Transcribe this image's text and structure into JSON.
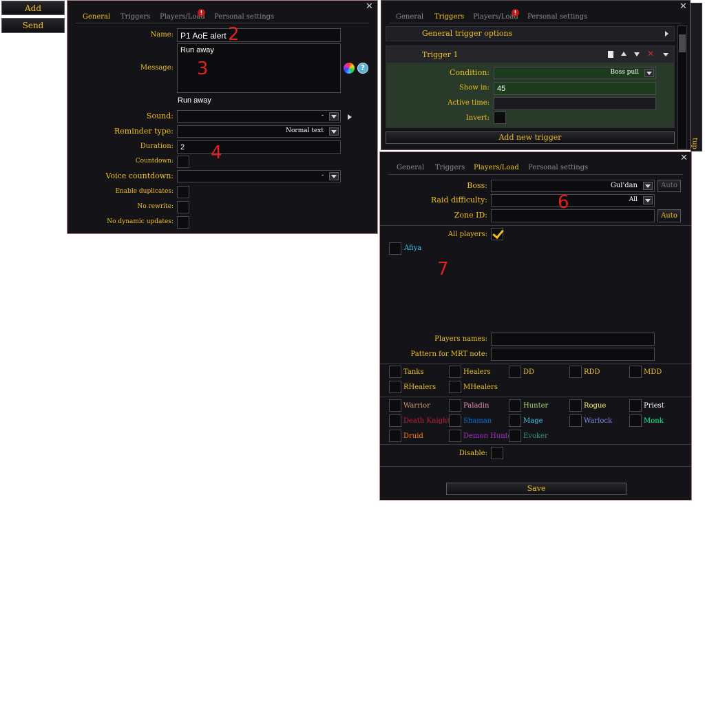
{
  "left_buttons": {
    "add": "Add",
    "send": "Send"
  },
  "tabs": {
    "general": "General",
    "triggers": "Triggers",
    "players_load": "Players/Load",
    "personal": "Personal settings",
    "alert": "!"
  },
  "close": "✕",
  "general": {
    "name_label": "Name:",
    "name_value": "P1 AoE alert",
    "message_label": "Message:",
    "message_value": "Run away",
    "message_preview": "Run away",
    "help": "?",
    "sound_label": "Sound:",
    "sound_value": "-",
    "reminder_label": "Reminder type:",
    "reminder_value": "Normal text",
    "duration_label": "Duration:",
    "duration_value": "2",
    "countdown_label": "Countdown:",
    "voice_label": "Voice countdown:",
    "voice_value": "-",
    "dup_label": "Enable duplicates:",
    "norewrite_label": "No rewrite:",
    "nodyn_label": "No dynamic updates:"
  },
  "triggers": {
    "general_options": "General trigger options",
    "trigger_title": "Trigger 1",
    "condition_label": "Condition:",
    "condition_value": "Boss pull",
    "showin_label": "Show in:",
    "showin_value": "45",
    "active_label": "Active time:",
    "invert_label": "Invert:",
    "add_new": "Add new trigger",
    "side_tab": "tup"
  },
  "load": {
    "boss_label": "Boss:",
    "boss_value": "Gul'dan",
    "auto": "Auto",
    "diff_label": "Raid difficulty:",
    "diff_value": "All",
    "zone_label": "Zone ID:",
    "zone_auto": "Auto",
    "allplayers_label": "All players:",
    "player_name": "Afiya",
    "names_label": "Players names:",
    "pattern_label": "Pattern for MRT note:",
    "roles": [
      "Tanks",
      "Healers",
      "DD",
      "RDD",
      "MDD",
      "RHealers",
      "MHealers"
    ],
    "classes": [
      {
        "name": "Warrior",
        "color": "#c69b6d"
      },
      {
        "name": "Paladin",
        "color": "#f48cba"
      },
      {
        "name": "Hunter",
        "color": "#aad372"
      },
      {
        "name": "Rogue",
        "color": "#fff468"
      },
      {
        "name": "Priest",
        "color": "#ffffff"
      },
      {
        "name": "Death Knight",
        "color": "#c41e3a"
      },
      {
        "name": "Shaman",
        "color": "#0070dd"
      },
      {
        "name": "Mage",
        "color": "#3fc7eb"
      },
      {
        "name": "Warlock",
        "color": "#8788ee"
      },
      {
        "name": "Monk",
        "color": "#00ff98"
      },
      {
        "name": "Druid",
        "color": "#ff7c0a"
      },
      {
        "name": "Demon Hunter",
        "color": "#a330c9"
      },
      {
        "name": "Evoker",
        "color": "#33937f"
      }
    ],
    "disable_label": "Disable:",
    "save": "Save"
  },
  "annotations": [
    "2",
    "3",
    "4",
    "6",
    "7"
  ]
}
